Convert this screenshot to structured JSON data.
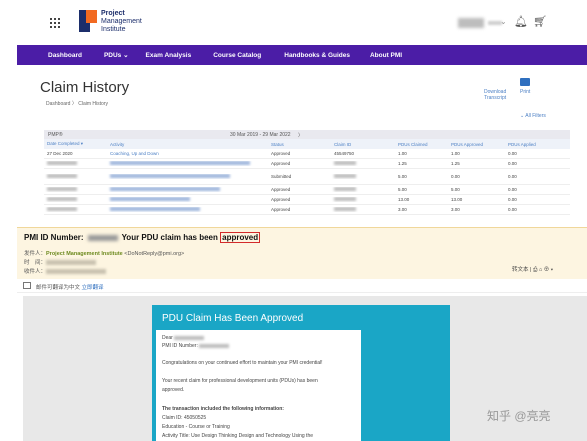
{
  "header": {
    "logo_line1": "Project",
    "logo_line2": "Management",
    "logo_line3": "Institute"
  },
  "nav": {
    "items": [
      "Dashboard",
      "PDUs ⌄",
      "Exam Analysis",
      "Course Catalog",
      "Handbooks & Guides",
      "About PMI"
    ]
  },
  "claims": {
    "title": "Claim History",
    "breadcrumb": "Dashboard  〉 Claim History",
    "download_line1": "Download",
    "download_line2": "Transcript",
    "print_label": "Print",
    "filters_label": "⌄ All Filters",
    "program": "PMP®",
    "date_range": "30 Mar 2019 - 29 Mar 2022",
    "date_nav": "〉",
    "columns": [
      "Date Completed ▾",
      "Activity",
      "Status",
      "Claim ID",
      "PDUs Claimed",
      "PDUs Approved",
      "PDUs Applied"
    ],
    "rows": [
      {
        "date": "27 Dec 2020",
        "activity": "Coaching, Up and Down",
        "status": "Approved",
        "claim": "45549750",
        "claimed": "1.00",
        "approved": "1.00",
        "applied": "0.00"
      },
      {
        "date": "",
        "activity": "",
        "status": "Approved",
        "claim": "",
        "claimed": "1.25",
        "approved": "1.25",
        "applied": "0.00"
      },
      {
        "date": "",
        "activity": "",
        "status": "Submitted",
        "claim": "",
        "claimed": "5.00",
        "approved": "0.00",
        "applied": "0.00"
      },
      {
        "date": "",
        "activity": "",
        "status": "Approved",
        "claim": "",
        "claimed": "5.00",
        "approved": "5.00",
        "applied": "0.00"
      },
      {
        "date": "",
        "activity": "",
        "status": "Approved",
        "claim": "",
        "claimed": "13.00",
        "approved": "13.00",
        "applied": "0.00"
      },
      {
        "date": "",
        "activity": "",
        "status": "Approved",
        "claim": "",
        "claimed": "3.00",
        "approved": "3.00",
        "applied": "0.00"
      }
    ]
  },
  "email": {
    "subject_prefix": "PMI ID Number:",
    "subject_mid": "Your PDU claim has been",
    "subject_highlight": "approved",
    "from_label": "发件人：",
    "sender_name": "Project Management Institute",
    "sender_email": "<DoNotReply@pmi.org>",
    "time_label": "时　间：",
    "to_label": "收件人：",
    "tools": "转文本 | ⎙ ⌂ ⊕ ▾",
    "translate_text": "邮件可翻译为中文",
    "translate_link": "立即翻译",
    "body_title": "PDU Claim Has Been Approved",
    "dear": "Dear",
    "pmi_id": "PMI ID Number:",
    "congrats": "Congratulations on your continued effort to maintain your PMI credential!",
    "recent1": "Your recent claim for professional development units (PDUs) has been",
    "recent2": "approved.",
    "transaction": "The transaction included the following information:",
    "claim_id": "Claim ID: 45050525",
    "education": "Education - Course or Training",
    "activity_title": "Activity Title: Use Design Thinking Design and Technology Using the"
  },
  "watermark": "知乎 @亮亮"
}
